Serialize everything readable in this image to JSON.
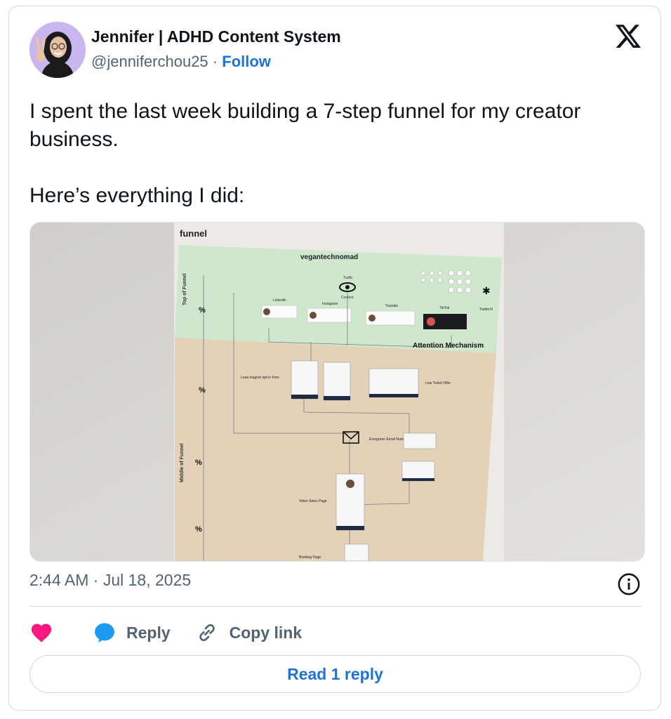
{
  "author": {
    "display_name": "Jennifer | ADHD Content System",
    "handle": "@jenniferchou25",
    "separator": "·",
    "follow_label": "Follow"
  },
  "brand_icon": "x-logo-icon",
  "tweet": {
    "paragraph_1": "I spent the last week building a 7-step funnel for my creator business.",
    "paragraph_2": "Here’s everything I did:"
  },
  "photo": {
    "board_title": "funnel",
    "top_label": "vegantechnomad",
    "traffic_label": "Traffic",
    "content_label": "Content",
    "platforms": [
      "LinkedIn",
      "Instagram",
      "Youtube",
      "TikTok",
      "Twitter/X"
    ],
    "side_label_top": "Top of Funnel",
    "side_label_middle": "Middle of Funnel",
    "attention_label": "Attention Mechanism",
    "lead_magnet_label": "Lead magnet opt-in form",
    "low_ticket_label": "Low Ticket Offer",
    "email_label": "Evergreen Email Nurturing Sequence",
    "video_sales_label": "Video Sales Page",
    "booking_label": "Booking Page",
    "percent": "%"
  },
  "timestamp": "2:44 AM · Jul 18, 2025",
  "actions": {
    "like_icon": "heart-icon",
    "reply_label": "Reply",
    "copy_label": "Copy link"
  },
  "read_replies_label": "Read 1 reply",
  "colors": {
    "link_blue": "#1d73d6",
    "heart_red": "#f91880",
    "reply_blue": "#1d9bf0",
    "text_gray": "#536471",
    "board_green": "#cfe7cc",
    "board_tan": "#e3d2b8"
  }
}
